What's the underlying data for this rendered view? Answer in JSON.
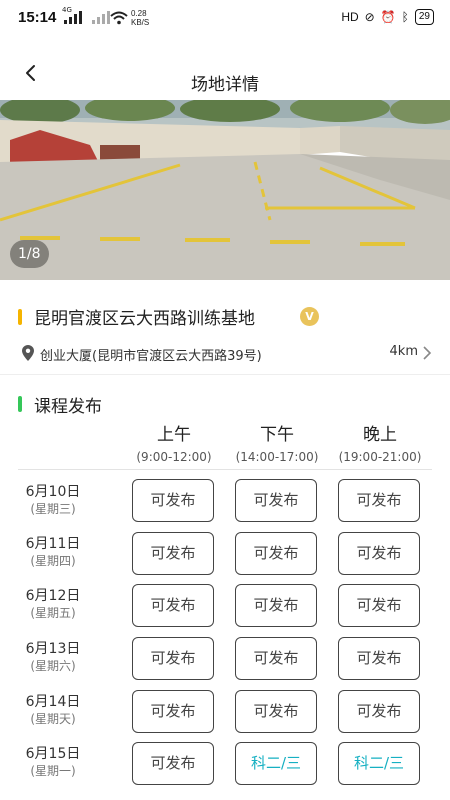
{
  "status_bar": {
    "time": "15:14",
    "net_left": "4G",
    "speed_value": "0.28",
    "speed_unit": "KB/S",
    "hd_label": "HD",
    "battery": "29"
  },
  "header": {
    "title": "场地详情"
  },
  "photo": {
    "counter": "1/8"
  },
  "venue": {
    "name": "昆明官渡区云大西路训练基地",
    "badge": "V",
    "address": "创业大厦(昆明市官渡区云大西路39号)",
    "distance": "4km"
  },
  "courses": {
    "section_title": "课程发布",
    "columns": [
      {
        "period": "上午",
        "hours": "(9:00-12:00)"
      },
      {
        "period": "下午",
        "hours": "(14:00-17:00)"
      },
      {
        "period": "晚上",
        "hours": "(19:00-21:00)"
      }
    ],
    "days": [
      {
        "date": "6月10日",
        "weekday": "(星期三)",
        "slots": [
          "可发布",
          "可发布",
          "可发布"
        ]
      },
      {
        "date": "6月11日",
        "weekday": "(星期四)",
        "slots": [
          "可发布",
          "可发布",
          "可发布"
        ]
      },
      {
        "date": "6月12日",
        "weekday": "(星期五)",
        "slots": [
          "可发布",
          "可发布",
          "可发布"
        ]
      },
      {
        "date": "6月13日",
        "weekday": "(星期六)",
        "slots": [
          "可发布",
          "可发布",
          "可发布"
        ]
      },
      {
        "date": "6月14日",
        "weekday": "(星期天)",
        "slots": [
          "可发布",
          "可发布",
          "可发布"
        ]
      },
      {
        "date": "6月15日",
        "weekday": "(星期一)",
        "slots": [
          "可发布",
          "科二/三",
          "科二/三"
        ]
      }
    ]
  },
  "colors": {
    "venue_accent": "#f5b400",
    "section_accent": "#35c759",
    "booked_text": "#16b0c2",
    "badge": "#e9c35b"
  }
}
